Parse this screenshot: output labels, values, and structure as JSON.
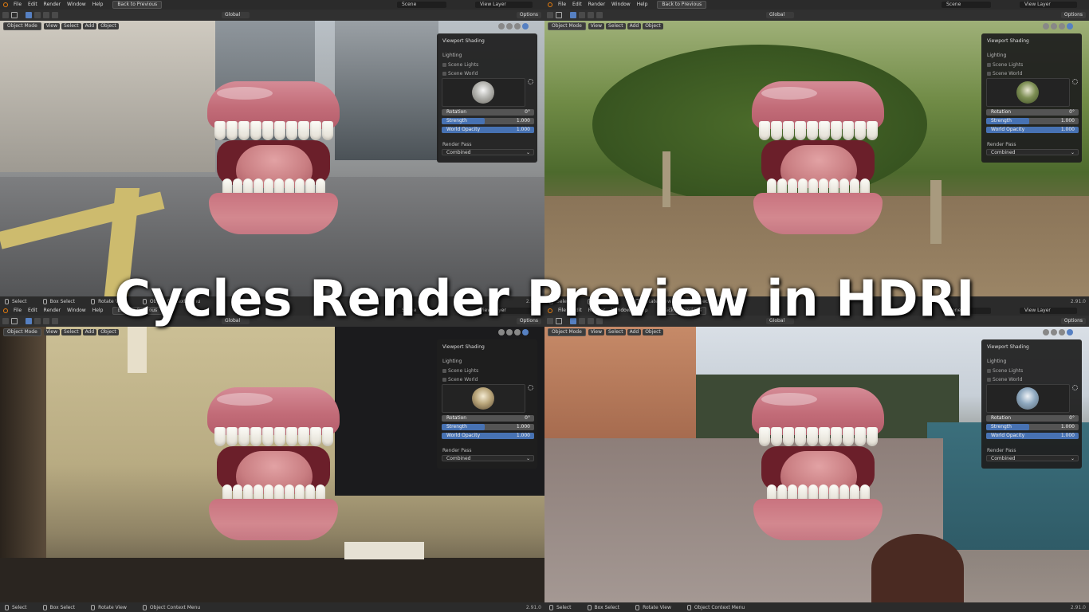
{
  "title_overlay": "Cycles Render Preview in HDRI",
  "topbar": {
    "menu": [
      "File",
      "Edit",
      "Render",
      "Window",
      "Help"
    ],
    "back_button": "Back to Previous",
    "scene": "Scene",
    "view_layer": "View Layer"
  },
  "toolbar": {
    "transform_orientation": "Global",
    "options": "Options"
  },
  "viewport_header": {
    "mode": "Object Mode",
    "view": "View",
    "select": "Select",
    "add": "Add",
    "object": "Object"
  },
  "shading_panel": {
    "title": "Viewport Shading",
    "lighting": "Lighting",
    "scene_lights": "Scene Lights",
    "scene_world": "Scene World",
    "rotation_label": "Rotation",
    "rotation_value": "0°",
    "strength_label": "Strength",
    "strength_value": "1.000",
    "world_opacity_label": "World Opacity",
    "world_opacity_value": "1.000",
    "render_pass_label": "Render Pass",
    "render_pass_value": "Combined"
  },
  "statusbar": {
    "select": "Select",
    "box_select": "Box Select",
    "rotate_view": "Rotate View",
    "context_menu": "Object Context Menu",
    "version": "2.91.0"
  },
  "colors": {
    "accent": "#4772b3",
    "active_icon": "#5680c2",
    "panel_bg": "#1e1e1e",
    "header_bg": "#2b2b2b"
  },
  "icons": [
    "blender-logo-icon",
    "cursor-icon",
    "select-box-icon",
    "gear-icon",
    "chevron-down-icon",
    "mouse-icon",
    "sphere-shading-icon"
  ]
}
